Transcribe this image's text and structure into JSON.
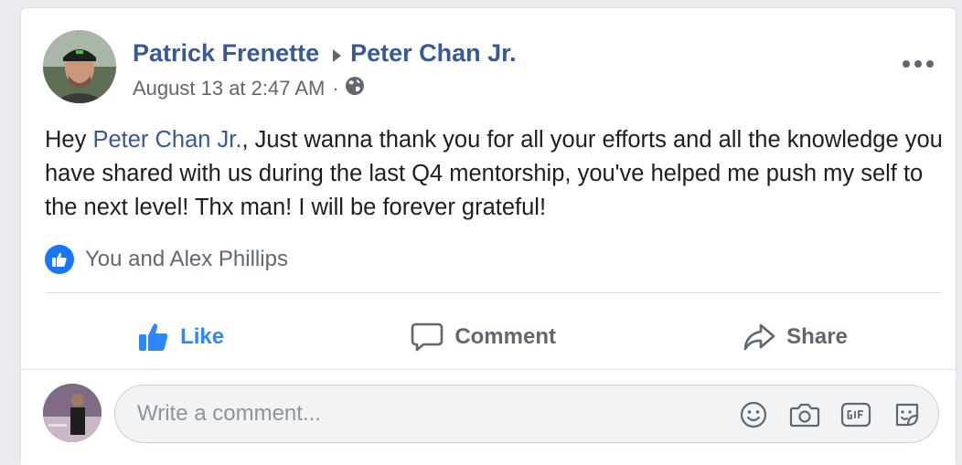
{
  "post": {
    "author": "Patrick Frenette",
    "recipient": "Peter Chan Jr.",
    "timestamp": "August 13 at 2:47 AM",
    "separator": "·",
    "privacy_icon": "globe-icon",
    "body_greeting": "Hey ",
    "body_mention": "Peter Chan Jr.",
    "body_rest": ", Just wanna thank you for all your efforts and all the knowledge you have shared with us during the last Q4 mentorship, you've helped me push my self to the next level! Thx man! I will be forever grateful!",
    "reactions_text": "You and Alex Phillips"
  },
  "actions": {
    "like": "Like",
    "comment": "Comment",
    "share": "Share"
  },
  "composer": {
    "placeholder": "Write a comment...",
    "tools": [
      "emoji-icon",
      "camera-icon",
      "gif-icon",
      "sticker-icon"
    ]
  },
  "colors": {
    "link": "#385898",
    "liked": "#2d88ff",
    "like_badge": "#1877f2",
    "muted": "#606770"
  }
}
